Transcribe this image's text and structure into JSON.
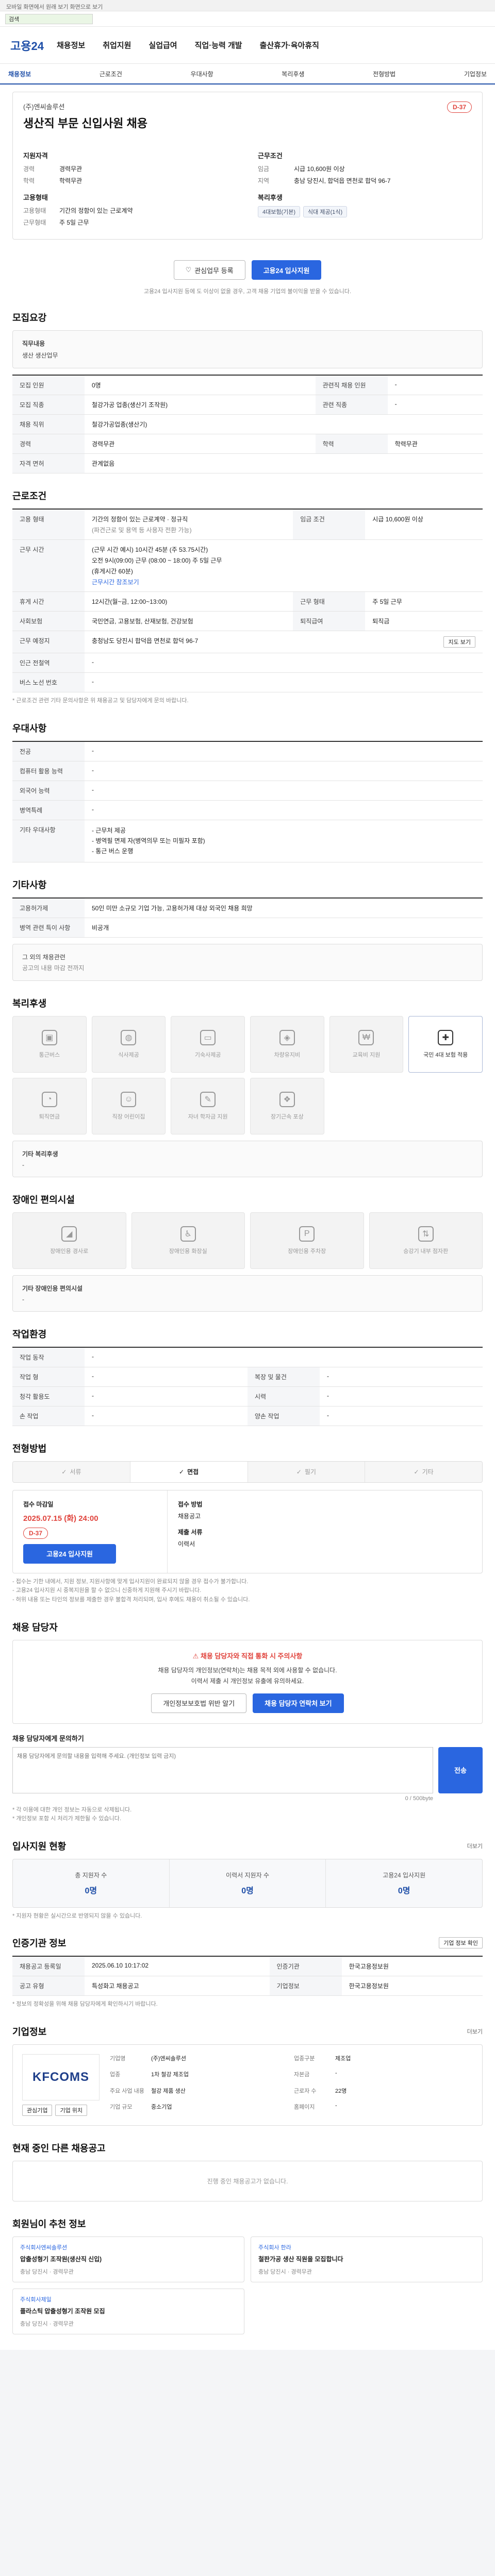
{
  "top_note": "모바일 화면에서 원래 보기 화면으로 보기",
  "search": {
    "value": "검색"
  },
  "header": {
    "logo": "고용24",
    "nav": [
      "채용정보",
      "취업지원",
      "실업급여",
      "직업·능력 개발",
      "출산휴가·육아휴직"
    ]
  },
  "subnav": [
    "채용정보",
    "근로조건",
    "우대사항",
    "복리후생",
    "전형방법",
    "기업정보"
  ],
  "job": {
    "company_label": "(주)엔씨솔루션",
    "title": "생산직 부문 신입사원 채용",
    "dday": "D-37",
    "qualification_label": "지원자격",
    "career_k": "경력",
    "career_v": "경력무관",
    "edu_k": "학력",
    "edu_v": "학력무관",
    "conditions_label": "근무조건",
    "pay_k": "임금",
    "pay_v": "시급 10,600원 이상",
    "loc_k": "지역",
    "loc_v": "충남 당진시, 합덕읍 면천로 합덕 96-7",
    "employment_label": "고용형태",
    "emp_k": "고용형태",
    "emp_v": "기간의 정함이 있는 근로계약",
    "hours_k": "근무형태",
    "hours_v": "주 5일 근무",
    "welfare_label": "복리후생",
    "welfare_chips": [
      "4대보험(기본)",
      "식대 제공(1식)"
    ]
  },
  "buttons": {
    "interest": "관심업무 등록",
    "apply": "고용24 입사지원"
  },
  "apply_note": "고용24 입사지원 등에 도 이상이 없을 경우, 고객 채용 기업의 불이익을 받을 수 있습니다.",
  "recruit": {
    "heading": "모집요강",
    "duty_label": "직무내용",
    "duty_value": "생산 생산업무",
    "rows": [
      [
        "모집 인원",
        "0명",
        "관련직 채용 인원",
        "-"
      ],
      [
        "모집 직종",
        "철강가공 업종(생산기 조작원)",
        "관련 직종",
        "-"
      ],
      [
        "채용 직위",
        "철강가공업종(생산기)",
        "",
        ""
      ],
      [
        "경력",
        "경력무관",
        "학력",
        "학력무관"
      ],
      [
        "자격 면허",
        "관계없음",
        "",
        ""
      ]
    ]
  },
  "work": {
    "heading": "근로조건",
    "emp_k": "고용 형태",
    "emp_v": "기간의 정함이 있는 근로계약 · 정규직",
    "emp_sub": "(파견근로 및 용역 등 사용자 전환 가능)",
    "wage_k": "임금 조건",
    "wage_v": "시급 10,600원 이상",
    "time_k": "근무 시간",
    "time_v": "(근무 시간 예시) 10시간 45분 (주 53.75시간)",
    "time_sub": "오전 9시(09:00) 근무 (08:00 ~ 18:00) 주 5일 근무",
    "time_sub2": "(휴게시간 60분)",
    "time_link": "근무시간 참조보기",
    "weekly_k": "휴게 시간",
    "weekly_v": "12시간(월~금, 12:00~13:00)",
    "day_k": "근무 형태",
    "day_v": "주 5일 근무",
    "social_k": "사회보험",
    "social_v": "국민연금, 고용보험, 산재보험, 건강보험",
    "retire_k": "퇴직급여",
    "retire_v": "퇴직금",
    "place_k": "근무 예정지",
    "place_v": "충청남도 당진시 합덕읍 면천로 합덕 96-7",
    "map_btn": "지도 보기",
    "near_k": "인근 전철역",
    "near_v": "-",
    "bus_k": "버스 노선 번호",
    "bus_v": "-",
    "note": "* 근로조건 관련 기타 문의사항은 위 채용공고 및 담당자에게 문의 바랍니다."
  },
  "preference": {
    "heading": "우대사항",
    "rows": [
      [
        "전공",
        "-"
      ],
      [
        "컴퓨터 활용 능력",
        "-"
      ],
      [
        "외국어 능력",
        "-"
      ],
      [
        "병역특례",
        "-"
      ],
      [
        "기타 우대사항",
        "- 근무처 제공\n- 병역필 면제 자(병역의무 또는 미필자 포함)\n- 통근 버스 운행"
      ]
    ]
  },
  "etc": {
    "heading": "기타사항",
    "rows": [
      [
        "고용허가제",
        "50인 미만 소규모 기업 가능, 고용허가제 대상 외국인 채용 희망"
      ],
      [
        "병역 관련 특이 사항",
        "비공개"
      ]
    ],
    "contact_btn": "그 외의 채용관련",
    "contact_note": "공고의 내용 마감 전까지"
  },
  "welfare": {
    "heading": "복리후생",
    "items": [
      {
        "icon": "truck-icon",
        "label": "통근버스",
        "on": false
      },
      {
        "icon": "food-icon",
        "label": "식사제공",
        "on": false
      },
      {
        "icon": "bed-icon",
        "label": "기숙사제공",
        "on": false
      },
      {
        "icon": "car-icon",
        "label": "차량유지비",
        "on": false
      },
      {
        "icon": "money-icon",
        "label": "교육비 지원",
        "on": false
      },
      {
        "icon": "insurance-icon",
        "label": "국민 4대 보험 적용",
        "on": true
      },
      {
        "icon": "retire-icon",
        "label": "퇴직연금",
        "on": false
      },
      {
        "icon": "childcare-icon",
        "label": "직장 어린이집",
        "on": false
      },
      {
        "icon": "doctor-icon",
        "label": "자녀 학자금 지원",
        "on": false
      },
      {
        "icon": "gift-icon",
        "label": "장기근속 포상",
        "on": false
      }
    ],
    "other_label": "기타 복리후생",
    "other_value": "-"
  },
  "disability": {
    "heading": "장애인 편의시설",
    "items": [
      {
        "icon": "ramp-icon",
        "label": "장애인용 경사로"
      },
      {
        "icon": "toilet-icon",
        "label": "장애인용 화장실"
      },
      {
        "icon": "parking-icon",
        "label": "장애인용 주차장"
      },
      {
        "icon": "lift-icon",
        "label": "승강기 내부 점자판"
      }
    ],
    "other_label": "기타 장애인용 편의시설",
    "other_value": "-"
  },
  "workenv": {
    "heading": "작업환경",
    "rows": [
      [
        "작업 동작",
        "-",
        "",
        ""
      ],
      [
        "작업 형",
        "-",
        "복장 및 물건",
        "-"
      ],
      [
        "청각 활용도",
        "-",
        "시력",
        "-"
      ],
      [
        "손 작업",
        "-",
        "양손 작업",
        "-"
      ]
    ]
  },
  "process": {
    "heading": "전형방법",
    "steps": [
      "서류",
      "면접",
      "필기",
      "기타"
    ],
    "active": 1,
    "apply_label": "접수 마감일",
    "apply_date": "2025.07.15 (화) 24:00",
    "dday": "D-37",
    "apply_btn": "고용24 입사지원",
    "method_label": "접수 방법",
    "method_value": "채용공고",
    "doc_label": "제출 서류",
    "doc_value": "이력서",
    "notes": [
      "- 접수는 기한 내에서, 지원 정보, 지원사항에 맞게 입사지원이 완료되지 않을 경우 접수가 불가합니다.",
      "- 고용24 입사지원 시 중복지원을 할 수 없으니 신중하게 지원해 주시기 바랍니다.",
      "- 허위 내용 또는 타인의 정보를 제출한 경우 불합격 처리되며, 입사 후에도 채용이 취소될 수 있습니다."
    ]
  },
  "contact": {
    "heading": "채용 담당자",
    "warn": "채용 담당자와 직접 통화 시 주의사항",
    "desc1": "채용 담당자의 개인정보(연락처)는 채용 목적 외에 사용할 수 없습니다.",
    "desc2": "이력서 제출 시 개인정보 유출에 유의하세요.",
    "btn_call": "개인정보보호법 위반 알기",
    "btn_check": "채용 담당자 연락처 보기",
    "inquiry_label": "채용 담당자에게 문의하기",
    "inquiry_placeholder": "채용 담당자에게 문의할 내용을 입력해 주세요. (개인정보 입력 금지)",
    "inquiry_count": "0 / 500byte",
    "send": "전송",
    "notes": [
      "* 각 이용에 대한 개인 정보는 자동으로 삭제됩니다.",
      "* 개인정보 포함 시 처리가 제한될 수 있습니다."
    ]
  },
  "applicants": {
    "heading": "입사지원 현황",
    "more": "더보기",
    "stats": [
      {
        "label": "총 지원자 수",
        "value": "0명"
      },
      {
        "label": "이력서 지원자 수",
        "value": "0명"
      },
      {
        "label": "고용24 입사지원",
        "value": "0명"
      }
    ],
    "note": "* 지원자 현황은 실시간으로 반영되지 않을 수 있습니다."
  },
  "info": {
    "heading": "인증기관 정보",
    "btn": "기업 정보 확인",
    "rows": [
      [
        "채용공고 등록일",
        "2025.06.10 10:17:02",
        "인증기관",
        "한국고용정보원"
      ],
      [
        "공고 유형",
        "특성화고 채용공고",
        "기업정보",
        "한국고용정보원"
      ]
    ],
    "note": "* 정보의 정확성을 위해 채용 담당자에게 확인하시기 바랍니다."
  },
  "company": {
    "heading": "기업정보",
    "more": "더보기",
    "logo": "KFCOMS",
    "rows": [
      [
        "기업명",
        "(주)엔씨솔루션",
        "업종구분",
        "제조업"
      ],
      [
        "업종",
        "1차 철강 제조업",
        "자본금",
        "-"
      ],
      [
        "주요 사업 내용",
        "철강 제품 생산",
        "근로자 수",
        "22명"
      ],
      [
        "기업 규모",
        "중소기업",
        "홈페이지",
        "-"
      ]
    ],
    "btn_interest": "관심기업",
    "btn_map": "기업 위치"
  },
  "same_company": {
    "heading": "현재 중인 다른 채용공고",
    "empty": "진행 중인 채용공고가 없습니다."
  },
  "recommend": {
    "heading": "회원님이 추천 정보",
    "cards": [
      {
        "company": "주식회사엔씨솔루션",
        "title": "압출성형기 조작원(생산직 신입)",
        "sub": "충남 당진시 · 경력무관"
      },
      {
        "company": "주식회사 한라",
        "title": "철판가공 생산 직원을 모집합니다",
        "sub": "충남 당진시 · 경력무관"
      },
      {
        "company": "주식회사제일",
        "title": "플라스틱 압출성형기 조작원 모집",
        "sub": "충남 당진시 · 경력무관"
      }
    ]
  }
}
